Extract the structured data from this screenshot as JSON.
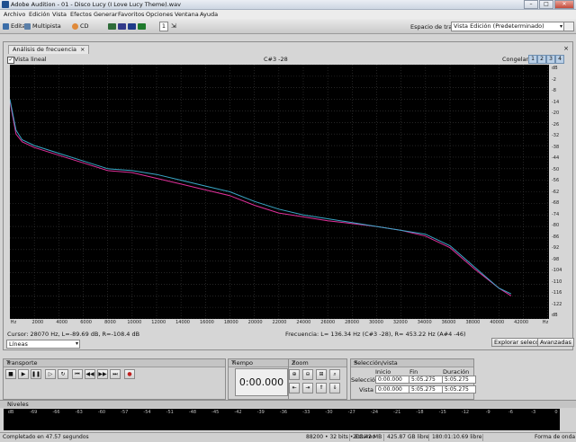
{
  "window": {
    "title": "Adobe Audition - 01 - Disco Lucy (I Love Lucy Theme).wav"
  },
  "menu": [
    "Archivo",
    "Edición",
    "Vista",
    "Efectos",
    "Generar",
    "Favoritos",
    "Opciones",
    "Ventana",
    "Ayuda"
  ],
  "toolbar": {
    "edit": "Editar",
    "multitrack": "Multipista",
    "cd": "CD",
    "page": "1"
  },
  "workspace": {
    "label": "Espacio de trabajo:",
    "value": "Vista Edición (Predeterminado)"
  },
  "analysis": {
    "tab": "Análisis de frecuencia",
    "linear_view": "Vista lineal",
    "note": "C#3 -28",
    "freeze_label": "Congelar:",
    "freeze_buttons": [
      "1",
      "2",
      "3",
      "4"
    ],
    "cursor": "Cursor:   28070 Hz, L=-89.69 dB, R=-108.4 dB",
    "frequency": "Frecuencia:    L= 136.34 Hz (C#3 -28), R= 453.22 Hz (A#4 -46)",
    "mode_select": "Líneas",
    "scan_button": "Explorar selección",
    "advanced_button": "Avanzadas"
  },
  "chart_data": {
    "type": "line",
    "x": [
      0,
      500,
      1000,
      2000,
      4000,
      6000,
      8000,
      10000,
      12000,
      14000,
      16000,
      18000,
      20000,
      22000,
      24000,
      26000,
      28000,
      30000,
      32000,
      34000,
      36000,
      38000,
      40000,
      41000
    ],
    "series": [
      {
        "color": "#3aa8c8",
        "values": [
          -14,
          -30,
          -35,
          -38,
          -42,
          -46,
          -50,
          -51,
          -53,
          -56,
          -59,
          -62,
          -67,
          -71,
          -74,
          -76,
          -78,
          -80,
          -82,
          -84,
          -90,
          -101,
          -112,
          -115
        ]
      },
      {
        "color": "#e0309a",
        "values": [
          -15,
          -32,
          -36,
          -39,
          -43,
          -47,
          -51,
          -52,
          -55,
          -58,
          -61,
          -64,
          -69,
          -73,
          -75,
          -77,
          -78.5,
          -80,
          -82,
          -85,
          -91,
          -102,
          -112,
          -116
        ]
      }
    ],
    "x_ticks": [
      "Hz",
      "2000",
      "4000",
      "6000",
      "8000",
      "10000",
      "12000",
      "14000",
      "16000",
      "18000",
      "20000",
      "22000",
      "24000",
      "26000",
      "28000",
      "30000",
      "32000",
      "34000",
      "36000",
      "38000",
      "40000",
      "42000",
      "Hz"
    ],
    "y_ticks": [
      "dB",
      "-2",
      "-8",
      "-14",
      "-20",
      "-26",
      "-32",
      "-38",
      "-44",
      "-50",
      "-56",
      "-62",
      "-68",
      "-74",
      "-80",
      "-86",
      "-92",
      "-98",
      "-104",
      "-110",
      "-116",
      "-122",
      "dB"
    ],
    "xlim": [
      0,
      44100
    ],
    "ylim": [
      -128,
      4
    ],
    "grid": true
  },
  "transport": {
    "title": "Transporte",
    "buttons": [
      "stop",
      "play",
      "pause",
      "play-from-cursor",
      "loop",
      "go-start",
      "rewind",
      "fast-forward",
      "go-end",
      "record"
    ]
  },
  "time": {
    "title": "Tiempo",
    "value": "0:00.000"
  },
  "zoom": {
    "title": "Zoom"
  },
  "selection": {
    "title": "Selección/vista",
    "headers": [
      "Inicio",
      "Fin",
      "Duración"
    ],
    "rows": [
      {
        "label": "Selección",
        "start": "0:00.000",
        "end": "5:05.275",
        "duration": "5:05.275"
      },
      {
        "label": "Vista",
        "start": "0:00.000",
        "end": "5:05.275",
        "duration": "5:05.275"
      }
    ]
  },
  "levels": {
    "title": "Niveles",
    "scale": [
      "dB",
      "-69",
      "-66",
      "-63",
      "-60",
      "-57",
      "-54",
      "-51",
      "-48",
      "-45",
      "-42",
      "-39",
      "-36",
      "-33",
      "-30",
      "-27",
      "-24",
      "-21",
      "-18",
      "-15",
      "-12",
      "-9",
      "-6",
      "-3",
      "0"
    ]
  },
  "status": {
    "completed": "Completado en 47.57 segundos",
    "format": "88200 • 32 bits • Estéreo",
    "size": "205.42 MB",
    "free": "425.87 GB libre",
    "free_time": "180:01:10.69 libre",
    "view": "Forma de onda"
  }
}
